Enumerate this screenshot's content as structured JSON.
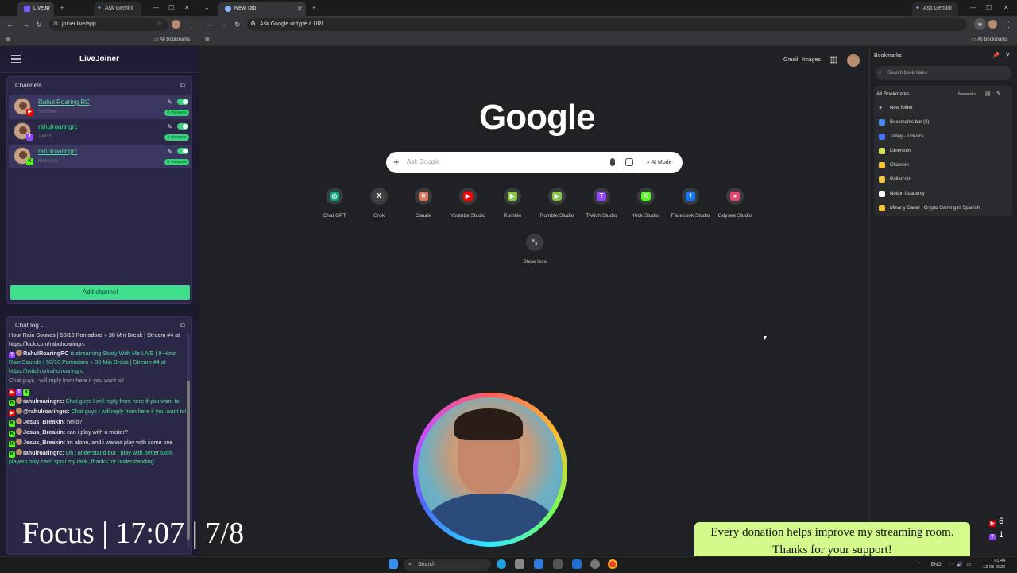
{
  "left_window": {
    "tabs": [
      {
        "label": "LiveJo"
      },
      {
        "label": "Ask Gemini"
      }
    ],
    "url": "joiner.live/app",
    "all_bookmarks": "All Bookmarks"
  },
  "app": {
    "title": "LiveJoiner",
    "channels_title": "Channels",
    "channels": [
      {
        "name": "Rahul Roaring RC",
        "platform": "YouTube",
        "viewers": "6 viewers",
        "badge": "Y",
        "badge_color": "#ff0000"
      },
      {
        "name": "rahulroaringrc",
        "platform": "Twitch",
        "viewers": "1 viewers",
        "badge": "T",
        "badge_color": "#9146ff"
      },
      {
        "name": "rahulroaringrc",
        "platform": "Kick.com",
        "viewers": "1 viewers",
        "badge": "K",
        "badge_color": "#53fc18"
      }
    ],
    "add_channel": "Add channel",
    "chat_log_title": "Chat log",
    "chat": [
      {
        "text": "Hour Rain Sounds | 50/10 Pomodoro + 30 Min Break | Stream #4 at https://kick.com/rahulroaringrc"
      },
      {
        "user": "RahulRoaringRC",
        "text": " is streaming Study With Me LIVE | 8-Hour Rain Sounds | 50/10 Pomodoro + 30 Min Break | Stream #4 at https://twitch.tv/rahulroaringrc"
      },
      {
        "text": "Chat guys I will reply from here if you want to!"
      },
      {
        "user": "rahulroaringrc:",
        "text": " Chat guys I will reply from here if you want to!"
      },
      {
        "user": "@rahulroaringrc:",
        "text": " Chat guys I will reply from here if you want to!"
      },
      {
        "user": "Jesus_Breakin:",
        "text": " hello?"
      },
      {
        "user": "Jesus_Breakin:",
        "text": " can i play with u mister?"
      },
      {
        "user": "Jesus_Breakin:",
        "text": " im alone, and i wanna play with some one"
      },
      {
        "user": "rahulroaringrc:",
        "text": " Oh i understand but I play with better skills players only can't spoil my rank, thanks for understanding"
      }
    ]
  },
  "right_window": {
    "tabs": [
      {
        "label": "New Tab"
      },
      {
        "label": "Ask Gemini"
      }
    ],
    "omnibox_placeholder": "Ask Google or type a URL",
    "all_bookmarks": "All Bookmarks",
    "header_links": {
      "gmail": "Gmail",
      "images": "Images"
    },
    "logo": "Google",
    "search_placeholder": "Ask Google",
    "ai_mode": "AI Mode",
    "shortcuts": [
      {
        "label": "Chat GPT",
        "glyph": "◎",
        "color": "#10a37f"
      },
      {
        "label": "Grok",
        "glyph": "X",
        "color": "#444"
      },
      {
        "label": "Claude",
        "glyph": "✳",
        "color": "#d97757"
      },
      {
        "label": "Youtube Studio",
        "glyph": "▶",
        "color": "#ff0000"
      },
      {
        "label": "Rumble",
        "glyph": "▶",
        "color": "#85c742"
      },
      {
        "label": "Rumble Studio",
        "glyph": "▶",
        "color": "#85c742"
      },
      {
        "label": "Twitch Studio",
        "glyph": "T",
        "color": "#9146ff"
      },
      {
        "label": "Kick Studio",
        "glyph": "K",
        "color": "#53fc18"
      },
      {
        "label": "Facebook Studio",
        "glyph": "f",
        "color": "#1877f2"
      },
      {
        "label": "Odysee Studio",
        "glyph": "●",
        "color": "#e8466b"
      }
    ],
    "show_less": "Show less",
    "bookmarks": {
      "title": "Bookmarks",
      "search_placeholder": "Search bookmarks",
      "section": "All Bookmarks",
      "sort": "Newest",
      "items": [
        {
          "label": "New folder",
          "color": "#202124"
        },
        {
          "label": "Bookmarks bar (3)",
          "color": "#4a8af4"
        },
        {
          "label": "Today - TickTick",
          "color": "#4772fa"
        },
        {
          "label": "Limercoin",
          "color": "#d4e157"
        },
        {
          "label": "Chainers",
          "color": "#f4c542"
        },
        {
          "label": "Rollercoin",
          "color": "#f4c542"
        },
        {
          "label": "Notion Academy",
          "color": "#ffffff"
        },
        {
          "label": "Minar y Ganar | Crypto Gaming in Spanish",
          "color": "#f4c542"
        }
      ]
    }
  },
  "overlay": {
    "focus": "Focus | 17:07 | 7/8",
    "donation_line1": "Every donation helps improve my streaming room.",
    "donation_line2": "Thanks for your support!",
    "youtube_count": "6",
    "twitch_count": "1"
  },
  "taskbar": {
    "search": "Search",
    "lang": "ENG",
    "time": "01:44",
    "date": "13-08-2026"
  }
}
